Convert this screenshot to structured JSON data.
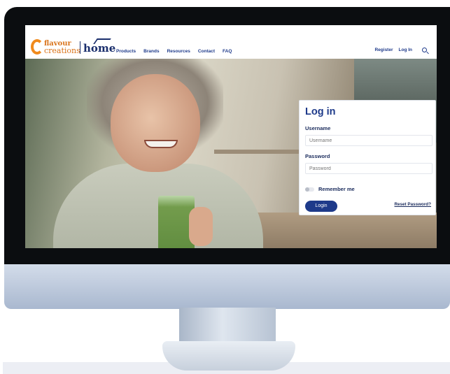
{
  "nav": {
    "logo_flavour": "flavour",
    "logo_creations": "creations",
    "logo_home": "home",
    "menu": [
      "Products",
      "Brands",
      "Resources",
      "Contact",
      "FAQ"
    ],
    "register_label": "Register",
    "login_label": "Log In"
  },
  "login": {
    "title": "Log in",
    "username_label": "Username",
    "username_placeholder": "Username",
    "password_label": "Password",
    "password_placeholder": "Password",
    "remember_label": "Remember me",
    "remember_checked": false,
    "button_label": "Login",
    "reset_label": "Reset Password?"
  },
  "colors": {
    "brand_navy": "#1e3a8a",
    "brand_orange": "#f08a1c"
  }
}
